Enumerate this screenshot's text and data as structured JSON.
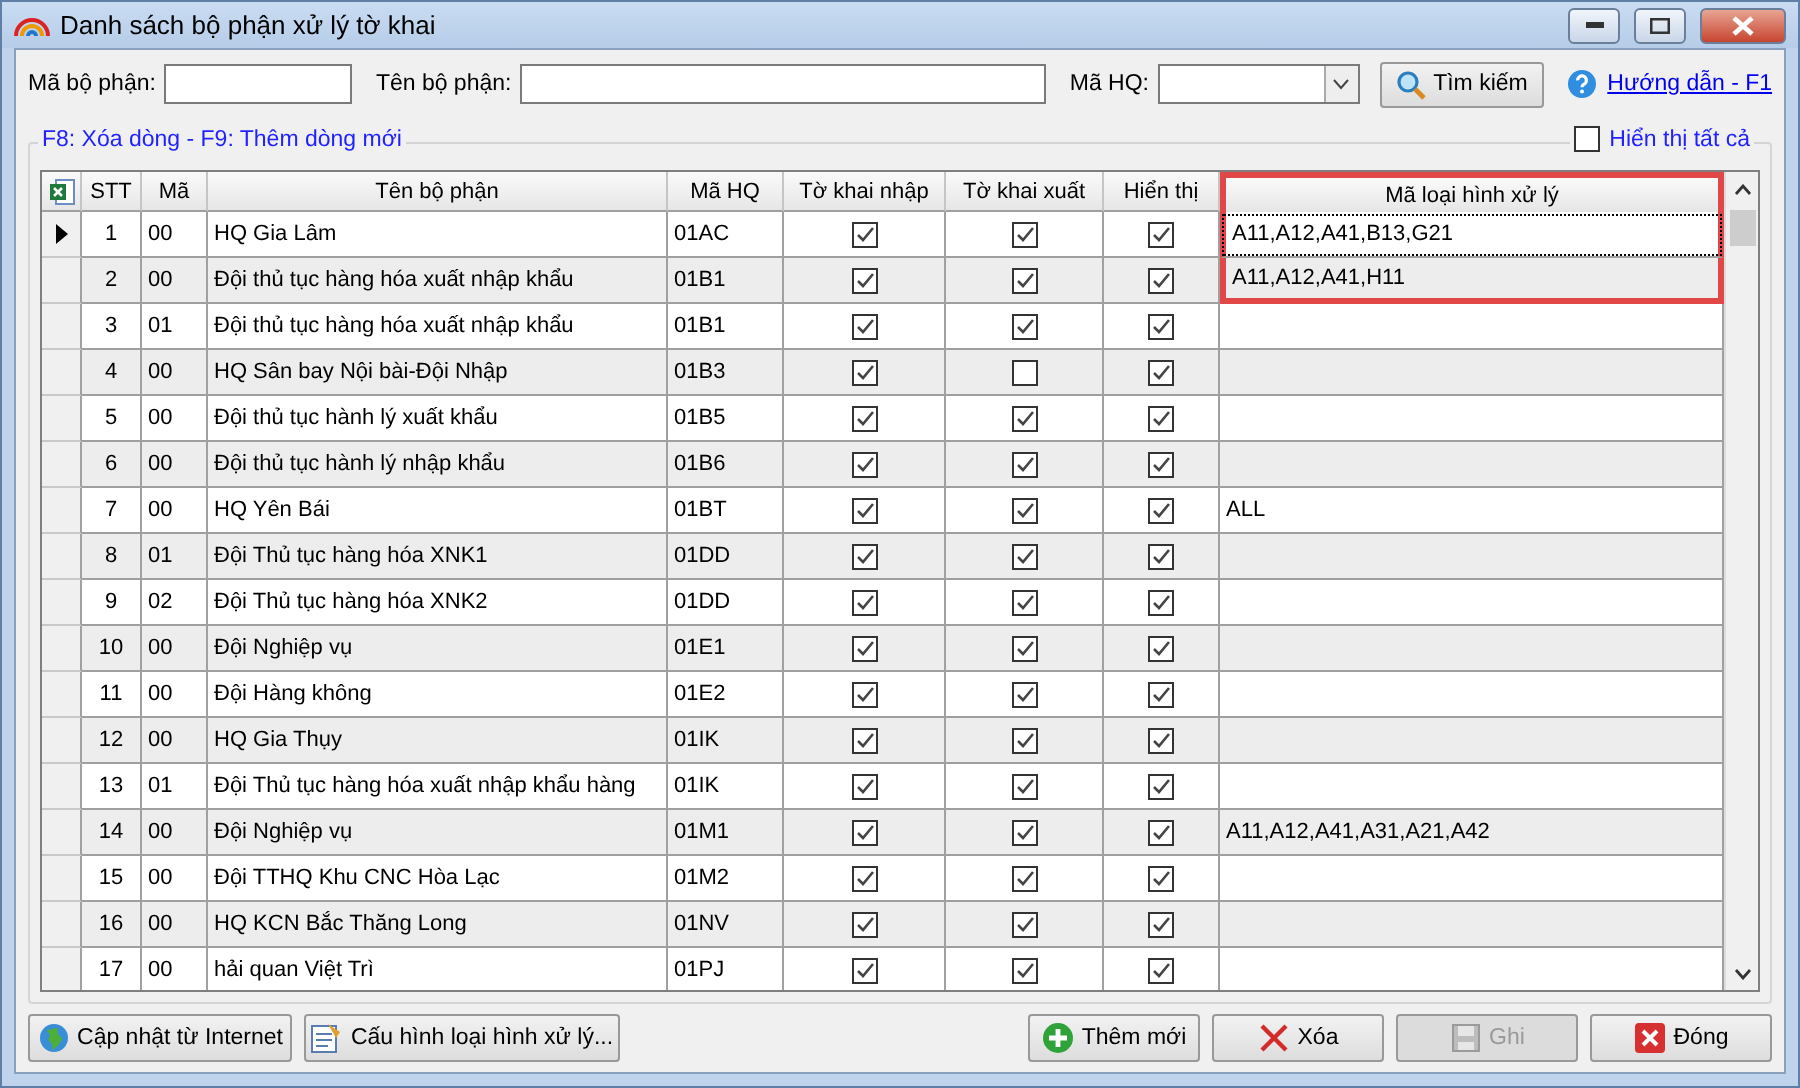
{
  "window": {
    "title": "Danh sách bộ phận xử lý tờ khai"
  },
  "search": {
    "fields": [
      {
        "label": "Mã bộ phận:"
      },
      {
        "label": "Tên bộ phận:"
      }
    ],
    "customs": {
      "label": "Mã HQ:"
    },
    "button": "Tìm kiếm",
    "help_link": "Hướng dẫn - F1"
  },
  "group": {
    "title": "F8: Xóa dòng - F9: Thêm dòng mới",
    "show_all": {
      "label": "Hiển thị tất cả",
      "checked": false
    }
  },
  "table": {
    "columns": [
      {
        "label": "STT",
        "highlighted": false
      },
      {
        "label": "Mã",
        "highlighted": false
      },
      {
        "label": "Tên bộ phận",
        "highlighted": false
      },
      {
        "label": "Mã HQ",
        "highlighted": false
      },
      {
        "label": "Tờ khai nhập",
        "highlighted": false
      },
      {
        "label": "Tờ khai xuất",
        "highlighted": false
      },
      {
        "label": "Hiển thị",
        "highlighted": false
      },
      {
        "label": "Mã loại hình xử lý",
        "highlighted": true
      }
    ],
    "rows": [
      {
        "stt": "1",
        "code": "00",
        "name": "HQ Gia Lâm",
        "customs": "01AC",
        "import": true,
        "export": true,
        "visible": true,
        "types": "A11,A12,A41,B13,G21",
        "selected": true,
        "highlighted": true
      },
      {
        "stt": "2",
        "code": "00",
        "name": "Đội thủ tục hàng hóa xuất nhập khẩu",
        "customs": "01B1",
        "import": true,
        "export": true,
        "visible": true,
        "types": "A11,A12,A41,H11",
        "selected": false,
        "highlighted": true
      },
      {
        "stt": "3",
        "code": "01",
        "name": "Đội thủ tục hàng hóa xuất nhập khẩu",
        "customs": "01B1",
        "import": true,
        "export": true,
        "visible": true,
        "selected": false,
        "highlighted": false
      },
      {
        "stt": "4",
        "code": "00",
        "name": "HQ Sân bay Nội bài-Đội Nhập",
        "customs": "01B3",
        "import": true,
        "export": false,
        "visible": true,
        "selected": false,
        "highlighted": false
      },
      {
        "stt": "5",
        "code": "00",
        "name": "Đội thủ tục hành lý xuất khẩu",
        "customs": "01B5",
        "import": true,
        "export": true,
        "visible": true,
        "selected": false,
        "highlighted": false
      },
      {
        "stt": "6",
        "code": "00",
        "name": "Đội thủ tục hành lý nhập khẩu",
        "customs": "01B6",
        "import": true,
        "export": true,
        "visible": true,
        "selected": false,
        "highlighted": false
      },
      {
        "stt": "7",
        "code": "00",
        "name": "HQ Yên Bái",
        "customs": "01BT",
        "import": true,
        "export": true,
        "visible": true,
        "types": "ALL",
        "selected": false,
        "highlighted": false
      },
      {
        "stt": "8",
        "code": "01",
        "name": "Đội Thủ tục hàng hóa XNK1",
        "customs": "01DD",
        "import": true,
        "export": true,
        "visible": true,
        "selected": false,
        "highlighted": false
      },
      {
        "stt": "9",
        "code": "02",
        "name": "Đội Thủ tục hàng hóa XNK2",
        "customs": "01DD",
        "import": true,
        "export": true,
        "visible": true,
        "selected": false,
        "highlighted": false
      },
      {
        "stt": "10",
        "code": "00",
        "name": "Đội Nghiệp vụ",
        "customs": "01E1",
        "import": true,
        "export": true,
        "visible": true,
        "selected": false,
        "highlighted": false
      },
      {
        "stt": "11",
        "code": "00",
        "name": "Đội Hàng không",
        "customs": "01E2",
        "import": true,
        "export": true,
        "visible": true,
        "selected": false,
        "highlighted": false
      },
      {
        "stt": "12",
        "code": "00",
        "name": "HQ Gia Thụy",
        "customs": "01IK",
        "import": true,
        "export": true,
        "visible": true,
        "selected": false,
        "highlighted": false
      },
      {
        "stt": "13",
        "code": "01",
        "name": "Đội Thủ tục hàng hóa xuất nhập khẩu hàng",
        "customs": "01IK",
        "import": true,
        "export": true,
        "visible": true,
        "selected": false,
        "highlighted": false
      },
      {
        "stt": "14",
        "code": "00",
        "name": "Đội Nghiệp vụ",
        "customs": "01M1",
        "import": true,
        "export": true,
        "visible": true,
        "types": "A11,A12,A41,A31,A21,A42",
        "selected": false,
        "highlighted": false
      },
      {
        "stt": "15",
        "code": "00",
        "name": "Đội TTHQ Khu CNC Hòa Lạc",
        "customs": "01M2",
        "import": true,
        "export": true,
        "visible": true,
        "selected": false,
        "highlighted": false
      },
      {
        "stt": "16",
        "code": "00",
        "name": "HQ KCN Bắc Thăng Long",
        "customs": "01NV",
        "import": true,
        "export": true,
        "visible": true,
        "selected": false,
        "highlighted": false
      },
      {
        "stt": "17",
        "code": "00",
        "name": "hải quan Việt Trì",
        "customs": "01PJ",
        "import": true,
        "export": true,
        "visible": true,
        "selected": false,
        "highlighted": false
      }
    ]
  },
  "left_buttons": [
    {
      "label": "Cập nhật từ Internet",
      "kind": "globe",
      "disabled": false
    },
    {
      "label": "Cấu hình loại hình xử lý...",
      "kind": "config",
      "disabled": false
    }
  ],
  "right_buttons": [
    {
      "label": "Thêm mới",
      "kind": "add",
      "disabled": false
    },
    {
      "label": "Xóa",
      "kind": "delete",
      "disabled": false
    },
    {
      "label": "Ghi",
      "kind": "save",
      "disabled": true
    },
    {
      "label": "Đóng",
      "kind": "close",
      "disabled": false
    }
  ]
}
